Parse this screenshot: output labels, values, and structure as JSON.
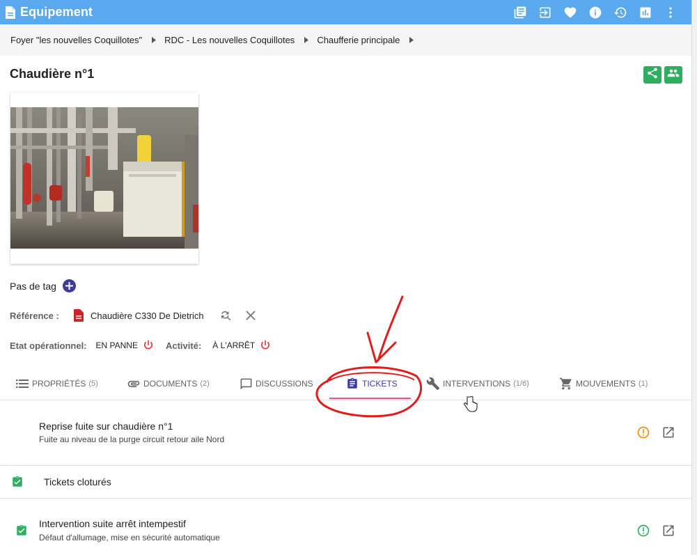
{
  "app": {
    "title": "Equipement",
    "accent_color": "#5aa8ee",
    "actions": [
      {
        "icon": "library-books-icon"
      },
      {
        "icon": "exit-to-app-icon"
      },
      {
        "icon": "favorite-heart-icon"
      },
      {
        "icon": "info-icon"
      },
      {
        "icon": "history-icon"
      },
      {
        "icon": "insert-chart-icon"
      },
      {
        "icon": "more-vert-icon"
      }
    ]
  },
  "breadcrumb": [
    {
      "label": "Foyer \"les nouvelles Coquillotes\""
    },
    {
      "label": "RDC - Les nouvelles Coquillotes"
    },
    {
      "label": "Chaufferie principale"
    }
  ],
  "equipment": {
    "name": "Chaudière n°1",
    "tag_text": "Pas de tag",
    "reference_label": "Référence :",
    "reference_value": "Chaudière C330 De Dietrich",
    "state_label": "Etat opérationnel:",
    "state_value": "EN PANNE",
    "activity_label": "Activité:",
    "activity_value": "À L'ARRÊT",
    "status_color": "#e53935",
    "share_color": "#2fae5f"
  },
  "tabs": [
    {
      "label": "Propriétés",
      "count": "(5)",
      "icon": "list-icon"
    },
    {
      "label": "Documents",
      "count": "(2)",
      "icon": "attachment-icon"
    },
    {
      "label": "Discussions",
      "count": "",
      "icon": "chat-bubble-icon"
    },
    {
      "label": "Tickets",
      "count": "",
      "icon": "assignment-icon",
      "active": true
    },
    {
      "label": "Interventions",
      "count": "(1/6)",
      "icon": "wrench-icon"
    },
    {
      "label": "Mouvements",
      "count": "(1)",
      "icon": "cart-icon"
    }
  ],
  "tickets_open": [
    {
      "title": "Reprise fuite sur chaudière n°1",
      "subtitle": "Fuite au niveau de la purge circuit retour aile Nord",
      "status_color": "#f08a00"
    }
  ],
  "closed_section": {
    "label": "Tickets cloturés",
    "icon_color": "#2fae5f"
  },
  "tickets_closed": [
    {
      "title": "Intervention suite arrêt intempestif",
      "subtitle": "Défaut d'allumage, mise en sécurité automatique",
      "status_color": "#2fae5f"
    }
  ]
}
